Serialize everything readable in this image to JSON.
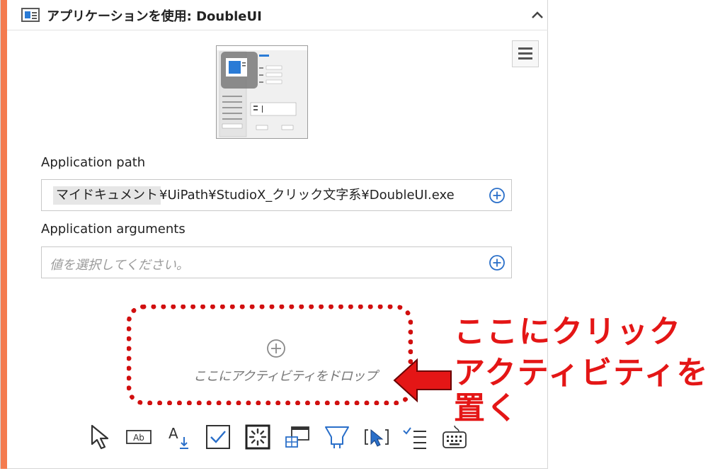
{
  "header": {
    "title": "アプリケーションを使用: DoubleUI",
    "icon": "window-icon",
    "collapse_icon": "chevron-up-icon"
  },
  "menu_icon": "hamburger-menu-icon",
  "application_path": {
    "label": "Application path",
    "chip": "マイドキュメント",
    "rest": "¥UiPath¥StudioX_クリック文字系¥DoubleUI.exe"
  },
  "application_arguments": {
    "label": "Application arguments",
    "placeholder": "値を選択してください。"
  },
  "dropzone": {
    "text": "ここにアクティビティをドロップ"
  },
  "callout": {
    "line1": "ここにクリック",
    "line2": "アクティビティを",
    "line3": "置く"
  },
  "colors": {
    "accent": "#f47b4f",
    "callout": "#e41616",
    "icon_blue": "#2a7bd6"
  },
  "toolbar_icons": [
    "click-icon",
    "get-text-icon",
    "type-into-icon",
    "check-icon",
    "wait-icon",
    "screenshot-table-icon",
    "highlight-icon",
    "select-item-icon",
    "checklist-icon",
    "keyboard-icon"
  ]
}
